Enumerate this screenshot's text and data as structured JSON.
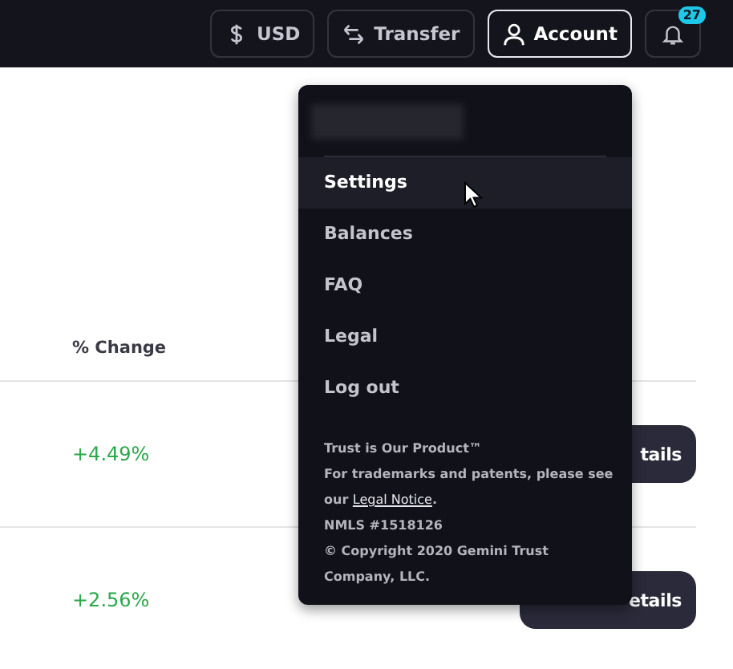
{
  "header": {
    "buttons": [
      {
        "kind": "currency",
        "label": "USD",
        "selected": false
      },
      {
        "kind": "transfer",
        "label": "Transfer",
        "selected": false
      },
      {
        "kind": "account",
        "label": "Account",
        "selected": true
      }
    ],
    "notifications": {
      "badge": "27"
    }
  },
  "table": {
    "columns": [
      "% Change"
    ],
    "rows": [
      {
        "change": "+4.49%",
        "action": "tails"
      },
      {
        "change": "+2.56%",
        "action": "etails"
      }
    ]
  },
  "account_menu": {
    "items": [
      {
        "label": "Settings",
        "selected": true
      },
      {
        "label": "Balances",
        "selected": false
      },
      {
        "label": "FAQ",
        "selected": false
      },
      {
        "label": "Legal",
        "selected": false
      },
      {
        "label": "Log out",
        "selected": false
      }
    ],
    "footer": {
      "tagline": "Trust is Our Product™",
      "notice": "For trademarks and patents, please see our ",
      "notice_link": "Legal Notice",
      "notice_end": ".",
      "nmls": "NMLS #1518126",
      "copyright": "© Copyright 2020 Gemini Trust Company, LLC."
    }
  }
}
